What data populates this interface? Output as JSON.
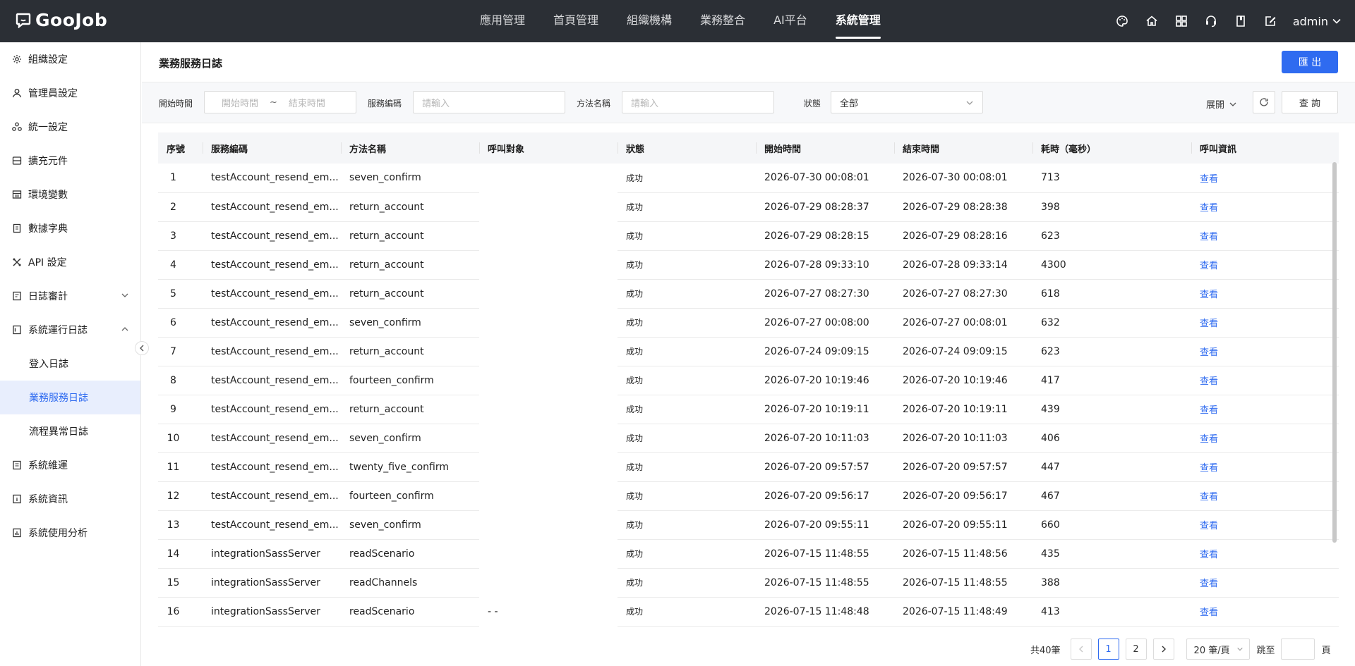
{
  "topbar": {
    "brand": "GooJob",
    "nav": [
      {
        "label": "應用管理",
        "active": false
      },
      {
        "label": "首頁管理",
        "active": false
      },
      {
        "label": "組織機構",
        "active": false
      },
      {
        "label": "業務整合",
        "active": false
      },
      {
        "label": "AI平台",
        "active": false
      },
      {
        "label": "系統管理",
        "active": true
      }
    ],
    "icons": [
      "palette-icon",
      "home-icon",
      "apps-grid-icon",
      "support-icon",
      "book-icon",
      "edit-doc-icon"
    ],
    "user": "admin"
  },
  "sidebar": {
    "items": [
      {
        "label": "組織設定",
        "icon": "gear-icon"
      },
      {
        "label": "管理員設定",
        "icon": "user-icon"
      },
      {
        "label": "統一設定",
        "icon": "cluster-icon"
      },
      {
        "label": "擴充元件",
        "icon": "box-icon"
      },
      {
        "label": "環境變數",
        "icon": "table-icon"
      },
      {
        "label": "數據字典",
        "icon": "dictionary-icon"
      },
      {
        "label": "API 設定",
        "icon": "api-icon"
      },
      {
        "label": "日誌審計",
        "icon": "audit-icon",
        "caret": "down"
      },
      {
        "label": "系統運行日誌",
        "icon": "log-icon",
        "caret": "up"
      },
      {
        "label": "登入日誌",
        "sub": true
      },
      {
        "label": "業務服務日誌",
        "sub": true,
        "active": true
      },
      {
        "label": "流程異常日誌",
        "sub": true
      },
      {
        "label": "系統維運",
        "icon": "maintain-icon"
      },
      {
        "label": "系統資訊",
        "icon": "info-doc-icon"
      },
      {
        "label": "系統使用分析",
        "icon": "analysis-icon"
      }
    ]
  },
  "page": {
    "title": "業務服務日誌",
    "export_label": "匯 出"
  },
  "filters": {
    "start_time_label": "開始時間",
    "start_placeholder": "開始時間",
    "separator": "~",
    "end_placeholder": "結束時間",
    "service_code_label": "服務編碼",
    "service_code_placeholder": "請輸入",
    "method_name_label": "方法名稱",
    "method_name_placeholder": "請輸入",
    "status_label": "狀態",
    "status_value": "全部",
    "expand_label": "展開",
    "query_label": "查 詢"
  },
  "table": {
    "columns": [
      "序號",
      "服務編碼",
      "方法名稱",
      "呼叫對象",
      "狀態",
      "開始時間",
      "結束時間",
      "耗時（毫秒）",
      "呼叫資訊"
    ],
    "rows": [
      {
        "idx": "1",
        "code": "testAccount_resend_em...",
        "method": "seven_confirm",
        "target": "",
        "status": "成功",
        "start": "2026-07-30 00:08:01",
        "end": "2026-07-30 00:08:01",
        "ms": "713",
        "link": "查看"
      },
      {
        "idx": "2",
        "code": "testAccount_resend_em...",
        "method": "return_account",
        "target": "",
        "status": "成功",
        "start": "2026-07-29 08:28:37",
        "end": "2026-07-29 08:28:38",
        "ms": "398",
        "link": "查看"
      },
      {
        "idx": "3",
        "code": "testAccount_resend_em...",
        "method": "return_account",
        "target": "",
        "status": "成功",
        "start": "2026-07-29 08:28:15",
        "end": "2026-07-29 08:28:16",
        "ms": "623",
        "link": "查看"
      },
      {
        "idx": "4",
        "code": "testAccount_resend_em...",
        "method": "return_account",
        "target": "",
        "status": "成功",
        "start": "2026-07-28 09:33:10",
        "end": "2026-07-28 09:33:14",
        "ms": "4300",
        "link": "查看"
      },
      {
        "idx": "5",
        "code": "testAccount_resend_em...",
        "method": "return_account",
        "target": "",
        "status": "成功",
        "start": "2026-07-27 08:27:30",
        "end": "2026-07-27 08:27:30",
        "ms": "618",
        "link": "查看"
      },
      {
        "idx": "6",
        "code": "testAccount_resend_em...",
        "method": "seven_confirm",
        "target": "",
        "status": "成功",
        "start": "2026-07-27 00:08:00",
        "end": "2026-07-27 00:08:01",
        "ms": "632",
        "link": "查看"
      },
      {
        "idx": "7",
        "code": "testAccount_resend_em...",
        "method": "return_account",
        "target": "",
        "status": "成功",
        "start": "2026-07-24 09:09:15",
        "end": "2026-07-24 09:09:15",
        "ms": "623",
        "link": "查看"
      },
      {
        "idx": "8",
        "code": "testAccount_resend_em...",
        "method": "fourteen_confirm",
        "target": "",
        "status": "成功",
        "start": "2026-07-20 10:19:46",
        "end": "2026-07-20 10:19:46",
        "ms": "417",
        "link": "查看"
      },
      {
        "idx": "9",
        "code": "testAccount_resend_em...",
        "method": "return_account",
        "target": "",
        "status": "成功",
        "start": "2026-07-20 10:19:11",
        "end": "2026-07-20 10:19:11",
        "ms": "439",
        "link": "查看"
      },
      {
        "idx": "10",
        "code": "testAccount_resend_em...",
        "method": "seven_confirm",
        "target": "",
        "status": "成功",
        "start": "2026-07-20 10:11:03",
        "end": "2026-07-20 10:11:03",
        "ms": "406",
        "link": "查看"
      },
      {
        "idx": "11",
        "code": "testAccount_resend_em...",
        "method": "twenty_five_confirm",
        "target": "",
        "status": "成功",
        "start": "2026-07-20 09:57:57",
        "end": "2026-07-20 09:57:57",
        "ms": "447",
        "link": "查看"
      },
      {
        "idx": "12",
        "code": "testAccount_resend_em...",
        "method": "fourteen_confirm",
        "target": "",
        "status": "成功",
        "start": "2026-07-20 09:56:17",
        "end": "2026-07-20 09:56:17",
        "ms": "467",
        "link": "查看"
      },
      {
        "idx": "13",
        "code": "testAccount_resend_em...",
        "method": "seven_confirm",
        "target": "",
        "status": "成功",
        "start": "2026-07-20 09:55:11",
        "end": "2026-07-20 09:55:11",
        "ms": "660",
        "link": "查看"
      },
      {
        "idx": "14",
        "code": "integrationSassServer",
        "method": "readScenario",
        "target": "",
        "status": "成功",
        "start": "2026-07-15 11:48:55",
        "end": "2026-07-15 11:48:56",
        "ms": "435",
        "link": "查看"
      },
      {
        "idx": "15",
        "code": "integrationSassServer",
        "method": "readChannels",
        "target": "",
        "status": "成功",
        "start": "2026-07-15 11:48:55",
        "end": "2026-07-15 11:48:55",
        "ms": "388",
        "link": "查看"
      },
      {
        "idx": "16",
        "code": "integrationSassServer",
        "method": "readScenario",
        "target": "- -",
        "status": "成功",
        "start": "2026-07-15 11:48:48",
        "end": "2026-07-15 11:48:49",
        "ms": "413",
        "link": "查看"
      }
    ]
  },
  "pagination": {
    "total": "共40筆",
    "pages": [
      "1",
      "2"
    ],
    "current": "1",
    "page_size": "20 筆/頁",
    "jump_label": "跳至",
    "page_label": "頁"
  },
  "colors": {
    "topbar": "#2b2f35",
    "accent": "#2f6bf0",
    "active_bg": "#e8eefd"
  }
}
